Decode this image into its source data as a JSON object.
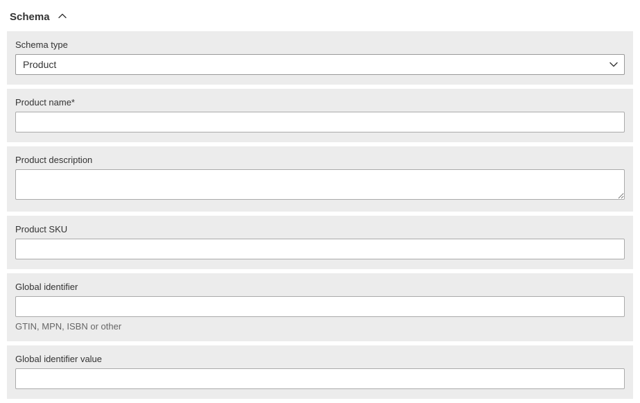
{
  "section": {
    "title": "Schema"
  },
  "fields": {
    "schema_type": {
      "label": "Schema type",
      "value": "Product"
    },
    "product_name": {
      "label": "Product name*",
      "value": ""
    },
    "product_description": {
      "label": "Product description",
      "value": ""
    },
    "product_sku": {
      "label": "Product SKU",
      "value": ""
    },
    "global_identifier": {
      "label": "Global identifier",
      "value": "",
      "help": "GTIN, MPN, ISBN or other"
    },
    "global_identifier_value": {
      "label": "Global identifier value",
      "value": ""
    }
  }
}
